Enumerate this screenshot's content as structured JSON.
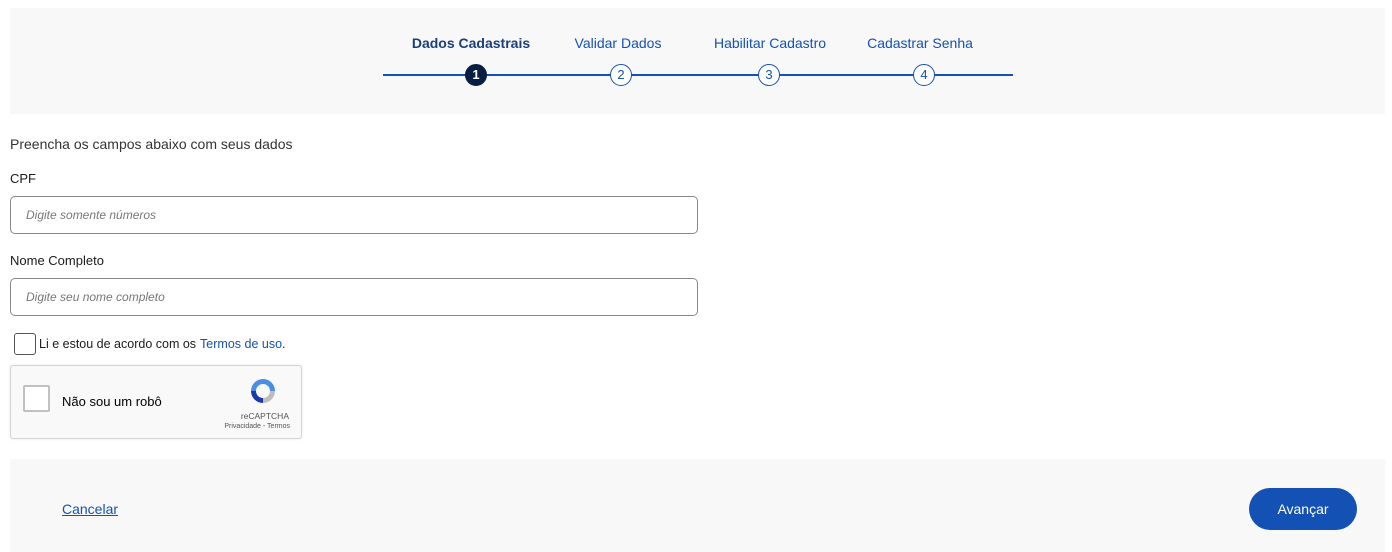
{
  "stepper": {
    "steps": [
      {
        "label": "Dados Cadastrais",
        "number": "1",
        "active": true
      },
      {
        "label": "Validar Dados",
        "number": "2",
        "active": false
      },
      {
        "label": "Habilitar Cadastro",
        "number": "3",
        "active": false
      },
      {
        "label": "Cadastrar Senha",
        "number": "4",
        "active": false
      }
    ]
  },
  "form": {
    "intro": "Preencha os campos abaixo com seus dados",
    "cpf": {
      "label": "CPF",
      "placeholder": "Digite somente números",
      "value": ""
    },
    "name": {
      "label": "Nome Completo",
      "placeholder": "Digite seu nome completo",
      "value": ""
    },
    "terms": {
      "text": "Li e estou de acordo com os",
      "link": "Termos de uso",
      "suffix": "."
    }
  },
  "recaptcha": {
    "label": "Não sou um robô",
    "brand": "reCAPTCHA",
    "links": "Privacidade - Termos"
  },
  "footer": {
    "cancel_label": "Cancelar",
    "advance_label": "Avançar"
  },
  "colors": {
    "accent": "#1351b4",
    "active_step": "#071d41",
    "panel_bg": "#f8f8f8"
  }
}
